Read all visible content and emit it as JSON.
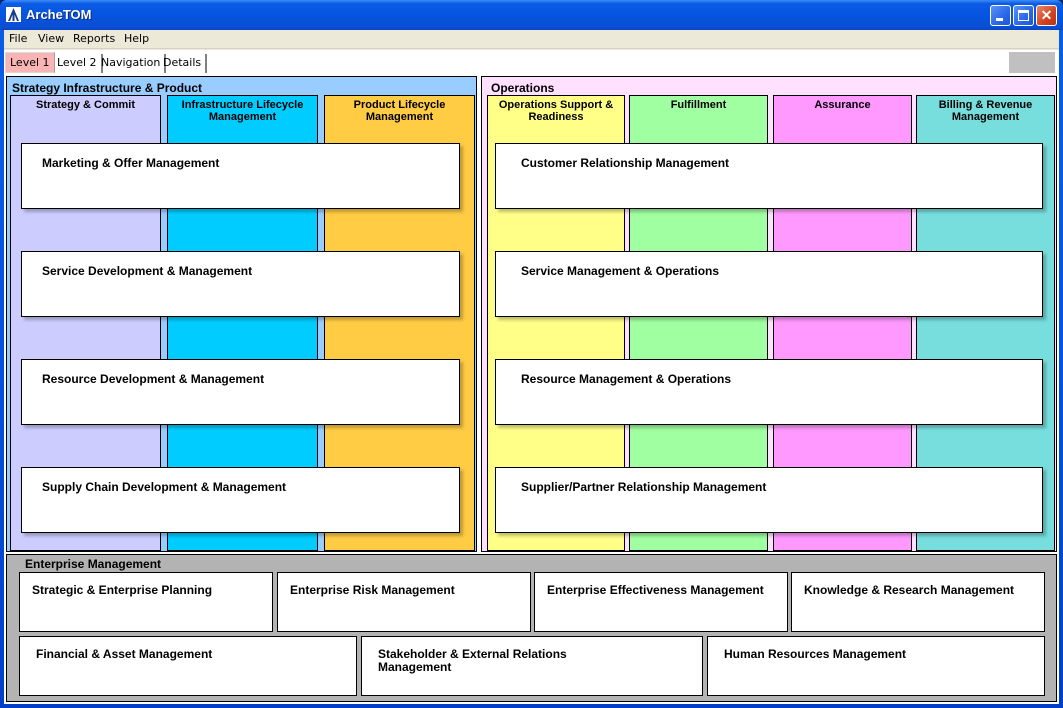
{
  "window": {
    "title": "ArcheTOM",
    "controls": {
      "minimize": "minimize",
      "maximize": "maximize",
      "close": "✕"
    }
  },
  "menu": [
    "File",
    "View",
    "Reports",
    "Help"
  ],
  "tabs": [
    {
      "label": "Level 1",
      "active": true
    },
    {
      "label": "Level 2",
      "active": false
    },
    {
      "label": "Navigation",
      "active": false
    },
    {
      "label": "Details",
      "active": false
    }
  ],
  "sip": {
    "title": "Strategy Infrastructure & Product",
    "background": "#99ccff",
    "columns": [
      {
        "label": "Strategy & Commit",
        "color": "#ccccff"
      },
      {
        "label": "Infrastructure Lifecycle Management",
        "color": "#00ccff"
      },
      {
        "label": "Product Lifecycle Management",
        "color": "#ffcc44"
      }
    ],
    "rows": [
      "Marketing & Offer Management",
      "Service Development & Management",
      "Resource Development & Management",
      "Supply Chain Development & Management"
    ]
  },
  "ops": {
    "title": "Operations",
    "background": "#ffe0ff",
    "columns": [
      {
        "label": "Operations Support & Readiness",
        "color": "#ffff88"
      },
      {
        "label": "Fulfillment",
        "color": "#a0ffa0"
      },
      {
        "label": "Assurance",
        "color": "#ff99ff"
      },
      {
        "label": "Billing & Revenue Management",
        "color": "#77dddd"
      }
    ],
    "rows": [
      "Customer Relationship Management",
      "Service Management & Operations",
      "Resource Management & Operations",
      "Supplier/Partner Relationship Management"
    ]
  },
  "enterprise": {
    "title": "Enterprise Management",
    "row1": [
      "Strategic & Enterprise Planning",
      "Enterprise Risk Management",
      "Enterprise Effectiveness Management",
      "Knowledge & Research Management"
    ],
    "row2": [
      "Financial & Asset Management",
      "Stakeholder & External Relations Management",
      "Human Resources Management"
    ]
  }
}
